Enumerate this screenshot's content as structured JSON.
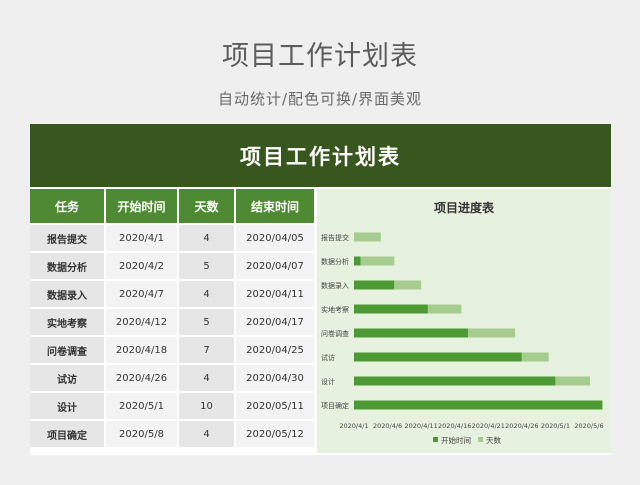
{
  "header": {
    "title": "项目工作计划表",
    "subtitle": "自动统计/配色可换/界面美观"
  },
  "sheet": {
    "banner_title": "项目工作计划表",
    "columns": [
      "任务",
      "开始时间",
      "天数",
      "结束时间"
    ],
    "rows": [
      [
        "报告提交",
        "2020/4/1",
        "4",
        "2020/04/05"
      ],
      [
        "数据分析",
        "2020/4/2",
        "5",
        "2020/04/07"
      ],
      [
        "数据录入",
        "2020/4/7",
        "4",
        "2020/04/11"
      ],
      [
        "实地考察",
        "2020/4/12",
        "5",
        "2020/04/17"
      ],
      [
        "问卷调查",
        "2020/4/18",
        "7",
        "2020/04/25"
      ],
      [
        "试访",
        "2020/4/26",
        "4",
        "2020/04/30"
      ],
      [
        "设计",
        "2020/5/1",
        "10",
        "2020/05/11"
      ],
      [
        "项目确定",
        "2020/5/8",
        "4",
        "2020/05/12"
      ]
    ]
  },
  "colors": {
    "banner": "#38571f",
    "header_green": "#4e8a34",
    "start_bar": "#4e9a34",
    "days_bar": "#a6cc90",
    "chart_bg": "#e6f1df"
  },
  "chart_data": {
    "type": "bar",
    "orientation": "horizontal",
    "stacked": true,
    "title": "项目进度表",
    "categories": [
      "报告提交",
      "数据分析",
      "数据录入",
      "实地考察",
      "问卷调查",
      "试访",
      "设计",
      "项目确定"
    ],
    "series": [
      {
        "name": "开始时间",
        "values": [
          "2020-04-01",
          "2020-04-02",
          "2020-04-07",
          "2020-04-12",
          "2020-04-18",
          "2020-04-26",
          "2020-05-01",
          "2020-05-08"
        ]
      },
      {
        "name": "天数",
        "values": [
          4,
          5,
          4,
          5,
          7,
          4,
          10,
          4
        ]
      }
    ],
    "x_range": [
      "2020-04-01",
      "2020-05-06"
    ],
    "x_ticks": [
      "2020/4/1",
      "2020/4/6",
      "2020/4/11",
      "2020/4/16",
      "2020/4/21",
      "2020/4/26",
      "2020/5/1",
      "2020/5/6"
    ],
    "legend": "bottom",
    "grid": false
  }
}
